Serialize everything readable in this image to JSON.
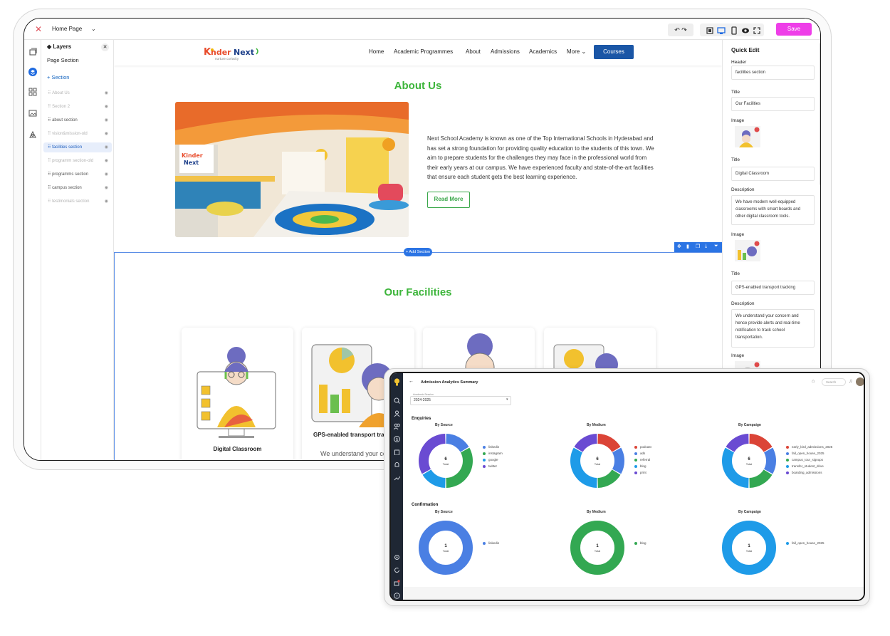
{
  "builder": {
    "page_select": "Home Page",
    "save_label": "Save",
    "layers": {
      "title": "Layers",
      "page_section": "Page Section",
      "add_section": "+ Section",
      "items": [
        {
          "label": "About Us",
          "state": "dim"
        },
        {
          "label": "Section 2",
          "state": "dim"
        },
        {
          "label": "about section",
          "state": "normal"
        },
        {
          "label": "vision&mission-old",
          "state": "dim"
        },
        {
          "label": "facilities section",
          "state": "selected"
        },
        {
          "label": "programm section-old",
          "state": "dim"
        },
        {
          "label": "programms section",
          "state": "normal"
        },
        {
          "label": "campus section",
          "state": "normal"
        },
        {
          "label": "testimonials section",
          "state": "dim"
        }
      ]
    },
    "site": {
      "logo_text": "KinderNext",
      "logo_tagline": "nurture curiosity",
      "nav": [
        "Home",
        "Academic Programmes",
        "About",
        "Admissions",
        "Academics",
        "More ⌄"
      ],
      "nav_cta": "Courses",
      "about_title": "About Us",
      "about_text": "Next School Academy is known as one of the Top International Schools in Hyderabad and has set a strong foundation for providing quality education to the students of this town. We aim to prepare students for the challenges they may face in the professional world from their early years at our campus. We have experienced faculty and state-of-the-art facilities that ensure each student gets the best learning experience.",
      "read_more": "Read More",
      "add_section": "+ Add Section",
      "facilities_title": "Our Facilities",
      "facility_cards": [
        {
          "title": "Digital Classroom"
        },
        {
          "title": "GPS-enabled transport tracking",
          "desc": "We understand your concern"
        },
        {
          "title": ""
        },
        {
          "title": ""
        }
      ]
    },
    "quick_edit": {
      "title": "Quick Edit",
      "header_label": "Header",
      "header_value": "facilities section",
      "title_label": "Title",
      "title_value": "Our Facilities",
      "image_label": "Image",
      "item1_title_label": "Title",
      "item1_title": "Digital Classroom",
      "item1_desc_label": "Description",
      "item1_desc": "We have modern well-equipped classrooms with smart boards and other digital classroom tools.",
      "image2_label": "Image",
      "item2_title_label": "Title",
      "item2_title": "GPS-enabled transport tracking",
      "item2_desc_label": "Description",
      "item2_desc": "We understand your concern and hence provide alerts and real-time notification to track school transportation.",
      "image3_label": "Image"
    }
  },
  "analytics": {
    "title": "Admission Analytics Summary",
    "search_placeholder": "Search",
    "year_label": "Academic Session",
    "year_value": "2024-2025",
    "enquiries_label": "Enquiries",
    "confirmation_label": "Confirmation",
    "colors": {
      "blue": "#4a7fe3",
      "green": "#33a852",
      "red": "#db4437",
      "purple": "#6a4bd2",
      "sky": "#1e9be8"
    },
    "enquiries": [
      {
        "title": "By Source",
        "total": "6",
        "total_label": "Total",
        "legend": [
          "linkedin",
          "instagram",
          "google",
          "twitter"
        ]
      },
      {
        "title": "By Medium",
        "total": "6",
        "total_label": "Total",
        "legend": [
          "podcast",
          "ads",
          "referral",
          "blog",
          "print"
        ]
      },
      {
        "title": "By Campaign",
        "total": "6",
        "total_label": "Total",
        "legend": [
          "early_bird_admissions_2025",
          "fall_open_house_2025",
          "campus_tour_signups",
          "transfer_student_drive",
          "boarding_admissions"
        ]
      }
    ],
    "confirmation": [
      {
        "title": "By Source",
        "total": "1",
        "total_label": "Total",
        "legend": [
          "linkedin"
        ]
      },
      {
        "title": "By Medium",
        "total": "1",
        "total_label": "Total",
        "legend": [
          "blog"
        ]
      },
      {
        "title": "By Campaign",
        "total": "1",
        "total_label": "Total",
        "legend": [
          "fall_open_house_2025"
        ]
      }
    ]
  },
  "chart_data": [
    {
      "type": "pie",
      "title": "By Source",
      "categories": [
        "linkedin",
        "instagram",
        "google",
        "twitter"
      ],
      "values": [
        1,
        2,
        1,
        2
      ],
      "colors": [
        "#4a7fe3",
        "#33a852",
        "#1e9be8",
        "#6a4bd2"
      ],
      "total": 6
    },
    {
      "type": "pie",
      "title": "By Medium",
      "categories": [
        "podcast",
        "ads",
        "referral",
        "blog",
        "print"
      ],
      "values": [
        1,
        1,
        1,
        2,
        1
      ],
      "colors": [
        "#db4437",
        "#4a7fe3",
        "#33a852",
        "#1e9be8",
        "#6a4bd2"
      ],
      "total": 6
    },
    {
      "type": "pie",
      "title": "By Campaign",
      "categories": [
        "early_bird_admissions_2025",
        "fall_open_house_2025",
        "campus_tour_signups",
        "transfer_student_drive",
        "boarding_admissions"
      ],
      "values": [
        1,
        1,
        1,
        2,
        1
      ],
      "colors": [
        "#db4437",
        "#4a7fe3",
        "#33a852",
        "#1e9be8",
        "#6a4bd2"
      ],
      "total": 6
    },
    {
      "type": "pie",
      "title": "By Source",
      "categories": [
        "linkedin"
      ],
      "values": [
        1
      ],
      "colors": [
        "#4a7fe3"
      ],
      "total": 1
    },
    {
      "type": "pie",
      "title": "By Medium",
      "categories": [
        "blog"
      ],
      "values": [
        1
      ],
      "colors": [
        "#33a852"
      ],
      "total": 1
    },
    {
      "type": "pie",
      "title": "By Campaign",
      "categories": [
        "fall_open_house_2025"
      ],
      "values": [
        1
      ],
      "colors": [
        "#1e9be8"
      ],
      "total": 1
    }
  ]
}
